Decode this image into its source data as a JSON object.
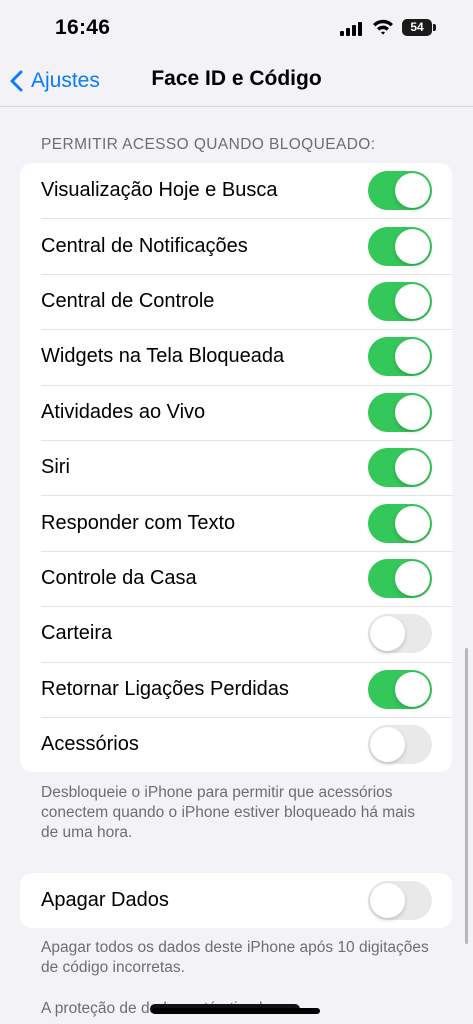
{
  "status_bar": {
    "time": "16:46",
    "battery": "54"
  },
  "nav": {
    "back_label": "Ajustes",
    "title": "Face ID e Código"
  },
  "lock_access": {
    "header": "PERMITIR ACESSO QUANDO BLOQUEADO:",
    "items": [
      {
        "label": "Visualização Hoje e Busca",
        "on": true
      },
      {
        "label": "Central de Notificações",
        "on": true
      },
      {
        "label": "Central de Controle",
        "on": true
      },
      {
        "label": "Widgets na Tela Bloqueada",
        "on": true
      },
      {
        "label": "Atividades ao Vivo",
        "on": true
      },
      {
        "label": "Siri",
        "on": true
      },
      {
        "label": "Responder com Texto",
        "on": true
      },
      {
        "label": "Controle da Casa",
        "on": true
      },
      {
        "label": "Carteira",
        "on": false
      },
      {
        "label": "Retornar Ligações Perdidas",
        "on": true
      },
      {
        "label": "Acessórios",
        "on": false
      }
    ],
    "footer": "Desbloqueie o iPhone para permitir que acessórios conectem quando o iPhone estiver bloqueado há mais de uma hora."
  },
  "erase_data": {
    "label": "Apagar Dados",
    "on": false,
    "footer": "Apagar todos os dados deste iPhone após 10 digitações de código incorretas.",
    "protection_note": "A proteção de dados está ativada."
  },
  "colors": {
    "accent": "#0a7aff",
    "toggle_on": "#34c759",
    "toggle_off": "#e9e9ea",
    "background": "#f2f2f7"
  },
  "icons": {
    "back": "chevron-left-icon",
    "signal": "cellular-signal-icon",
    "wifi": "wifi-icon",
    "battery": "battery-icon"
  }
}
